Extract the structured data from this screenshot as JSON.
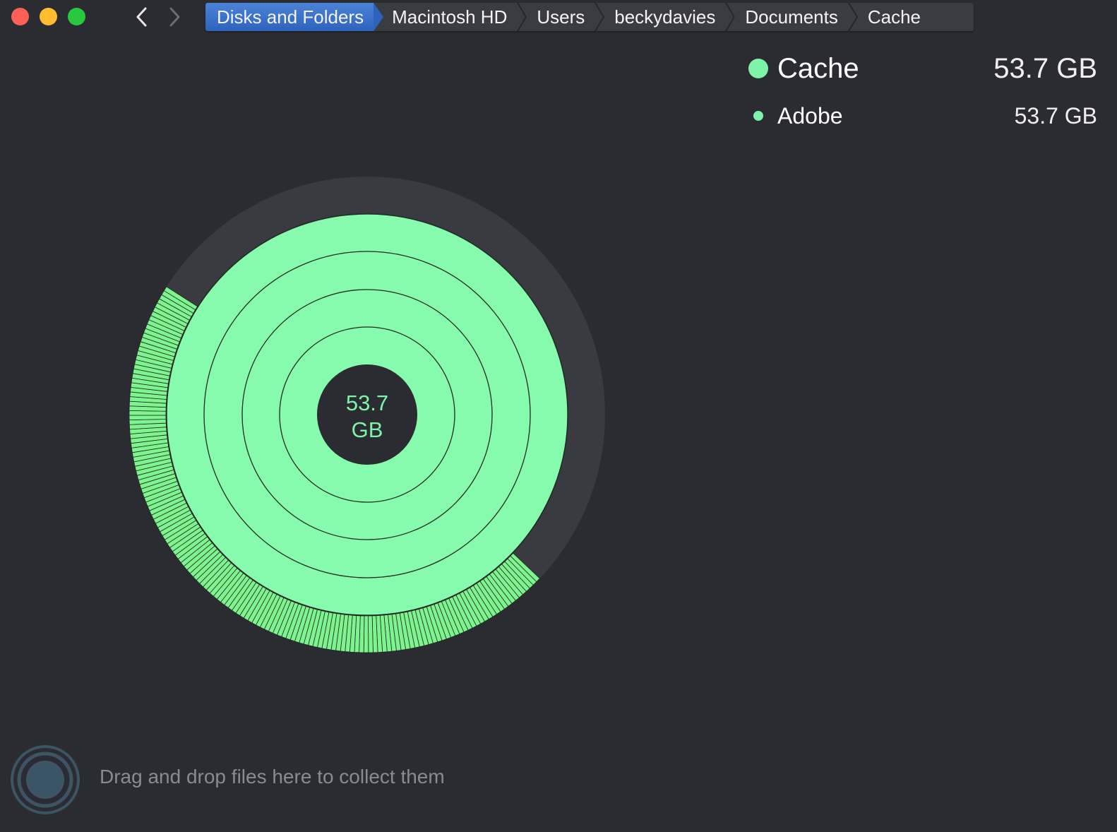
{
  "window": {
    "controls": [
      "close-button",
      "minimize-button",
      "maximize-button"
    ]
  },
  "navigation": {
    "back_icon": "chevron-left-icon",
    "forward_icon": "chevron-right-icon"
  },
  "breadcrumb": [
    {
      "label": "Disks and Folders",
      "active": true
    },
    {
      "label": "Macintosh HD"
    },
    {
      "label": "Users"
    },
    {
      "label": "beckydavies"
    },
    {
      "label": "Documents"
    },
    {
      "label": "Cache"
    }
  ],
  "legend": [
    {
      "name": "Cache",
      "size": "53.7 GB",
      "color": "#7ef3a9"
    },
    {
      "name": "Adobe",
      "size": "53.7 GB",
      "color": "#7ef3a9"
    }
  ],
  "chart": {
    "center_value": "53.7",
    "center_unit": "GB",
    "colors": {
      "segment": "#86fbad",
      "outer_segment": "#7ef48f",
      "track": "#3a3b40",
      "hole": "#2b2c31"
    }
  },
  "drop_zone": {
    "icon": "drop-target-icon",
    "hint": "Drag and drop files here to collect them"
  }
}
